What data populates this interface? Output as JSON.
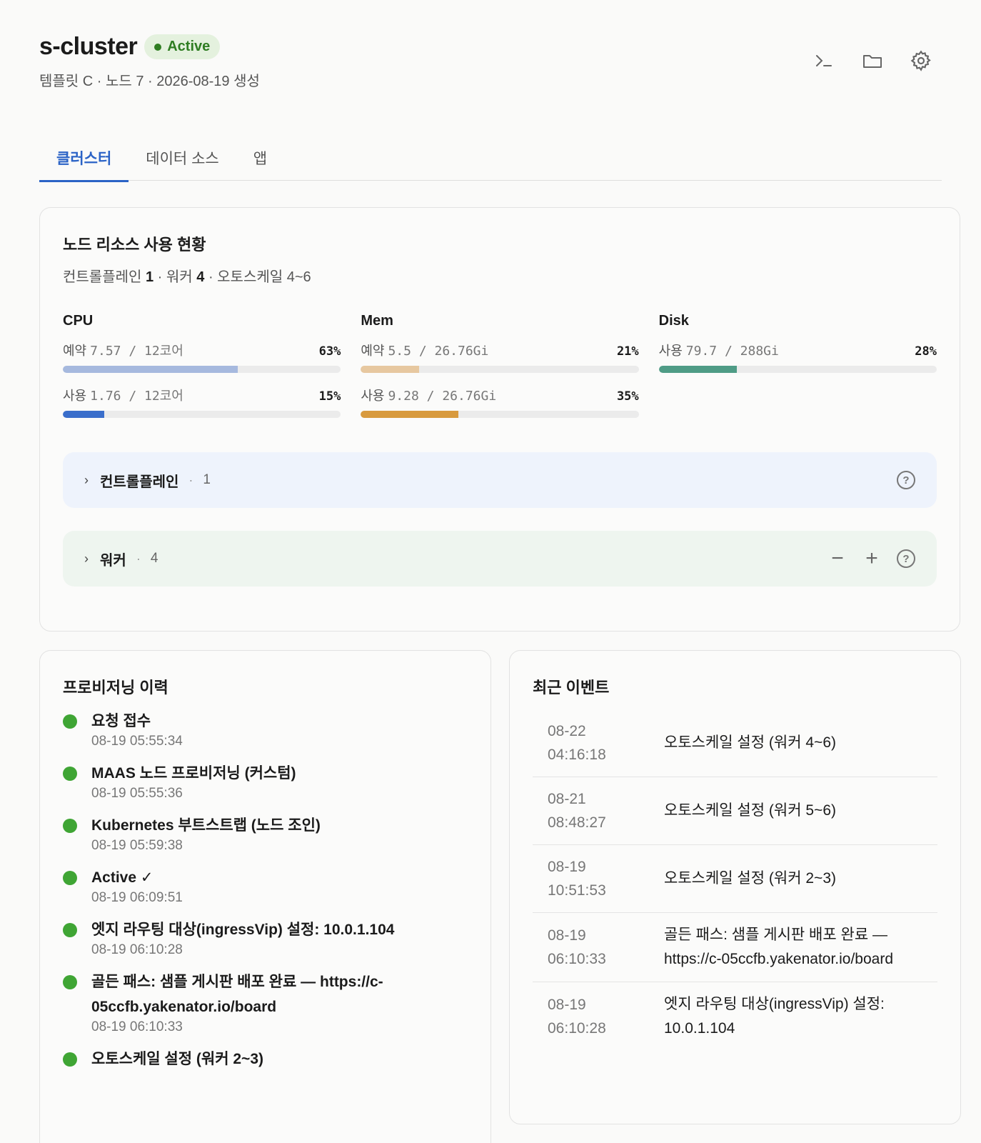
{
  "header": {
    "title": "s-cluster",
    "status": "Active",
    "subtitle": "템플릿 C · 노드 7 · 2026-08-19 생성"
  },
  "toolbar_icons": [
    "terminal-icon",
    "folder-icon",
    "gear-icon"
  ],
  "tabs": [
    {
      "label": "클러스터",
      "active": true
    },
    {
      "label": "데이터 소스",
      "active": false
    },
    {
      "label": "앱",
      "active": false
    }
  ],
  "resources": {
    "title": "노드 리소스 사용 현황",
    "sub_prefix_cp": "컨트롤플레인",
    "sub_cp_count": "1",
    "sub_sep1": "· 워커",
    "sub_worker_count": "4",
    "sub_suffix": "· 오토스케일 4~6",
    "metrics": [
      {
        "title": "CPU",
        "bars": [
          {
            "label": "예약",
            "value": "7.57 / 12코어",
            "pct_text": "63%",
            "pct": 63,
            "color": "#a6b9de"
          },
          {
            "label": "사용",
            "value": "1.76 / 12코어",
            "pct_text": "15%",
            "pct": 15,
            "color": "#3a6ecb"
          }
        ]
      },
      {
        "title": "Mem",
        "bars": [
          {
            "label": "예약",
            "value": "5.5 / 26.76Gi",
            "pct_text": "21%",
            "pct": 21,
            "color": "#e7c8a0"
          },
          {
            "label": "사용",
            "value": "9.28 / 26.76Gi",
            "pct_text": "35%",
            "pct": 35,
            "color": "#d89a3e"
          }
        ]
      },
      {
        "title": "Disk",
        "bars": [
          {
            "label": "사용",
            "value": "79.7 / 288Gi",
            "pct_text": "28%",
            "pct": 28,
            "color": "#4f9c86"
          }
        ]
      }
    ],
    "groups": {
      "control_plane": {
        "name": "컨트롤플레인",
        "count": "1"
      },
      "worker": {
        "name": "워커",
        "count": "4"
      }
    }
  },
  "history": {
    "title": "프로비저닝 이력",
    "items": [
      {
        "label": "요청 접수",
        "time": "08-19 05:55:34"
      },
      {
        "label": "MAAS 노드 프로비저닝 (커스텀)",
        "time": "08-19 05:55:36"
      },
      {
        "label": "Kubernetes 부트스트랩 (노드 조인)",
        "time": "08-19 05:59:38"
      },
      {
        "label": "Active ✓",
        "time": "08-19 06:09:51"
      },
      {
        "label": "엣지 라우팅 대상(ingressVip) 설정: 10.0.1.104",
        "time": "08-19 06:10:28"
      },
      {
        "label": "골든 패스: 샘플 게시판 배포 완료 — https://c-05ccfb.yakenator.io/board",
        "time": "08-19 06:10:33"
      },
      {
        "label": "오토스케일 설정 (워커 2~3)",
        "time": ""
      }
    ]
  },
  "events": {
    "title": "최근 이벤트",
    "items": [
      {
        "date": "08-22",
        "time": "04:16:18",
        "text": "오토스케일 설정 (워커 4~6)"
      },
      {
        "date": "08-21",
        "time": "08:48:27",
        "text": "오토스케일 설정 (워커 5~6)"
      },
      {
        "date": "08-19",
        "time": "10:51:53",
        "text": "오토스케일 설정 (워커 2~3)"
      },
      {
        "date": "08-19",
        "time": "06:10:33",
        "text": "골든 패스: 샘플 게시판 배포 완료 — https://c-05ccfb.yakenator.io/board"
      },
      {
        "date": "08-19",
        "time": "06:10:28",
        "text": "엣지 라우팅 대상(ingressVip) 설정: 10.0.1.104"
      }
    ]
  }
}
